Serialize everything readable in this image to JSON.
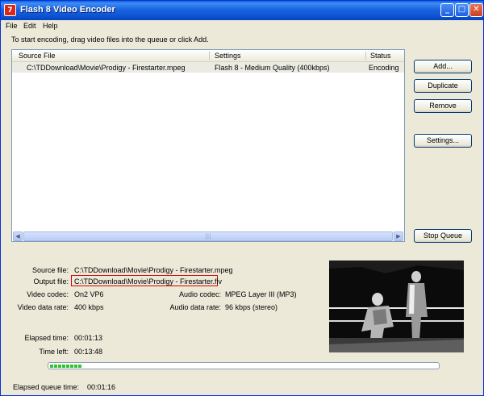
{
  "window": {
    "title": "Flash 8 Video Encoder",
    "icon": "app-icon",
    "icon_glyph": "7"
  },
  "titlebar_buttons": {
    "minimize": "_",
    "maximize": "□",
    "close": "✕"
  },
  "menu": [
    "File",
    "Edit",
    "Help"
  ],
  "instruction": "To start encoding, drag video files into the queue or click Add.",
  "queue": {
    "columns": [
      "Source File",
      "Settings",
      "Status"
    ],
    "rows": [
      {
        "source": "C:\\TDDownload\\Movie\\Prodigy - Firestarter.mpeg",
        "settings": "Flash 8 - Medium Quality (400kbps)",
        "status": "Encoding"
      }
    ],
    "scroll": {
      "left": "◀",
      "right": "▶",
      "grip": "|||"
    }
  },
  "buttons": {
    "add": "Add...",
    "duplicate": "Duplicate",
    "remove": "Remove",
    "settings": "Settings...",
    "stop_queue": "Stop Queue"
  },
  "details": {
    "source_label": "Source file:",
    "source_value": "C:\\TDDownload\\Movie\\Prodigy - Firestarter.mpeg",
    "output_label": "Output file:",
    "output_value": "C:\\TDDownload\\Movie\\Prodigy - Firestarter.flv",
    "video_codec_label": "Video codec:",
    "video_codec_value": "On2 VP6",
    "audio_codec_label": "Audio codec:",
    "audio_codec_value": "MPEG Layer III (MP3)",
    "video_rate_label": "Video data rate:",
    "video_rate_value": "400 kbps",
    "audio_rate_label": "Audio data rate:",
    "audio_rate_value": "96 kbps (stereo)",
    "elapsed_label": "Elapsed time:",
    "elapsed_value": "00:01:13",
    "timeleft_label": "Time left:",
    "timeleft_value": "00:13:48"
  },
  "progress": {
    "fraction": 0.09,
    "color": "#32c233"
  },
  "status": {
    "queue_label": "Elapsed queue time:",
    "queue_value": "00:01:16"
  },
  "colors": {
    "title_bar": "#0a4fd0",
    "window_bg": "#ece9d8",
    "output_highlight": "#d40000"
  }
}
